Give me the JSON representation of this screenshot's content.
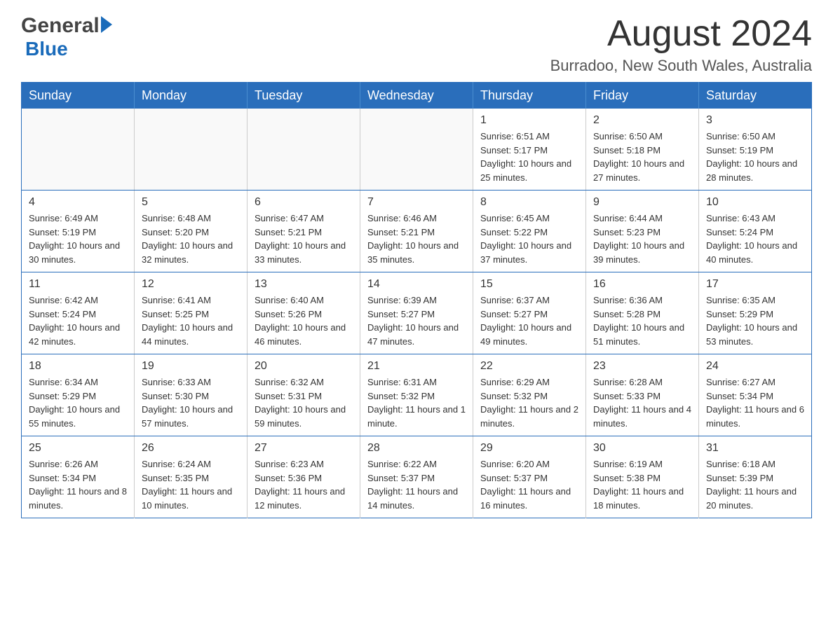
{
  "header": {
    "logo_general": "General",
    "logo_blue": "Blue",
    "main_title": "August 2024",
    "subtitle": "Burradoo, New South Wales, Australia"
  },
  "calendar": {
    "days_of_week": [
      "Sunday",
      "Monday",
      "Tuesday",
      "Wednesday",
      "Thursday",
      "Friday",
      "Saturday"
    ],
    "weeks": [
      {
        "days": [
          {
            "number": "",
            "info": ""
          },
          {
            "number": "",
            "info": ""
          },
          {
            "number": "",
            "info": ""
          },
          {
            "number": "",
            "info": ""
          },
          {
            "number": "1",
            "info": "Sunrise: 6:51 AM\nSunset: 5:17 PM\nDaylight: 10 hours and 25 minutes."
          },
          {
            "number": "2",
            "info": "Sunrise: 6:50 AM\nSunset: 5:18 PM\nDaylight: 10 hours and 27 minutes."
          },
          {
            "number": "3",
            "info": "Sunrise: 6:50 AM\nSunset: 5:19 PM\nDaylight: 10 hours and 28 minutes."
          }
        ]
      },
      {
        "days": [
          {
            "number": "4",
            "info": "Sunrise: 6:49 AM\nSunset: 5:19 PM\nDaylight: 10 hours and 30 minutes."
          },
          {
            "number": "5",
            "info": "Sunrise: 6:48 AM\nSunset: 5:20 PM\nDaylight: 10 hours and 32 minutes."
          },
          {
            "number": "6",
            "info": "Sunrise: 6:47 AM\nSunset: 5:21 PM\nDaylight: 10 hours and 33 minutes."
          },
          {
            "number": "7",
            "info": "Sunrise: 6:46 AM\nSunset: 5:21 PM\nDaylight: 10 hours and 35 minutes."
          },
          {
            "number": "8",
            "info": "Sunrise: 6:45 AM\nSunset: 5:22 PM\nDaylight: 10 hours and 37 minutes."
          },
          {
            "number": "9",
            "info": "Sunrise: 6:44 AM\nSunset: 5:23 PM\nDaylight: 10 hours and 39 minutes."
          },
          {
            "number": "10",
            "info": "Sunrise: 6:43 AM\nSunset: 5:24 PM\nDaylight: 10 hours and 40 minutes."
          }
        ]
      },
      {
        "days": [
          {
            "number": "11",
            "info": "Sunrise: 6:42 AM\nSunset: 5:24 PM\nDaylight: 10 hours and 42 minutes."
          },
          {
            "number": "12",
            "info": "Sunrise: 6:41 AM\nSunset: 5:25 PM\nDaylight: 10 hours and 44 minutes."
          },
          {
            "number": "13",
            "info": "Sunrise: 6:40 AM\nSunset: 5:26 PM\nDaylight: 10 hours and 46 minutes."
          },
          {
            "number": "14",
            "info": "Sunrise: 6:39 AM\nSunset: 5:27 PM\nDaylight: 10 hours and 47 minutes."
          },
          {
            "number": "15",
            "info": "Sunrise: 6:37 AM\nSunset: 5:27 PM\nDaylight: 10 hours and 49 minutes."
          },
          {
            "number": "16",
            "info": "Sunrise: 6:36 AM\nSunset: 5:28 PM\nDaylight: 10 hours and 51 minutes."
          },
          {
            "number": "17",
            "info": "Sunrise: 6:35 AM\nSunset: 5:29 PM\nDaylight: 10 hours and 53 minutes."
          }
        ]
      },
      {
        "days": [
          {
            "number": "18",
            "info": "Sunrise: 6:34 AM\nSunset: 5:29 PM\nDaylight: 10 hours and 55 minutes."
          },
          {
            "number": "19",
            "info": "Sunrise: 6:33 AM\nSunset: 5:30 PM\nDaylight: 10 hours and 57 minutes."
          },
          {
            "number": "20",
            "info": "Sunrise: 6:32 AM\nSunset: 5:31 PM\nDaylight: 10 hours and 59 minutes."
          },
          {
            "number": "21",
            "info": "Sunrise: 6:31 AM\nSunset: 5:32 PM\nDaylight: 11 hours and 1 minute."
          },
          {
            "number": "22",
            "info": "Sunrise: 6:29 AM\nSunset: 5:32 PM\nDaylight: 11 hours and 2 minutes."
          },
          {
            "number": "23",
            "info": "Sunrise: 6:28 AM\nSunset: 5:33 PM\nDaylight: 11 hours and 4 minutes."
          },
          {
            "number": "24",
            "info": "Sunrise: 6:27 AM\nSunset: 5:34 PM\nDaylight: 11 hours and 6 minutes."
          }
        ]
      },
      {
        "days": [
          {
            "number": "25",
            "info": "Sunrise: 6:26 AM\nSunset: 5:34 PM\nDaylight: 11 hours and 8 minutes."
          },
          {
            "number": "26",
            "info": "Sunrise: 6:24 AM\nSunset: 5:35 PM\nDaylight: 11 hours and 10 minutes."
          },
          {
            "number": "27",
            "info": "Sunrise: 6:23 AM\nSunset: 5:36 PM\nDaylight: 11 hours and 12 minutes."
          },
          {
            "number": "28",
            "info": "Sunrise: 6:22 AM\nSunset: 5:37 PM\nDaylight: 11 hours and 14 minutes."
          },
          {
            "number": "29",
            "info": "Sunrise: 6:20 AM\nSunset: 5:37 PM\nDaylight: 11 hours and 16 minutes."
          },
          {
            "number": "30",
            "info": "Sunrise: 6:19 AM\nSunset: 5:38 PM\nDaylight: 11 hours and 18 minutes."
          },
          {
            "number": "31",
            "info": "Sunrise: 6:18 AM\nSunset: 5:39 PM\nDaylight: 11 hours and 20 minutes."
          }
        ]
      }
    ]
  }
}
